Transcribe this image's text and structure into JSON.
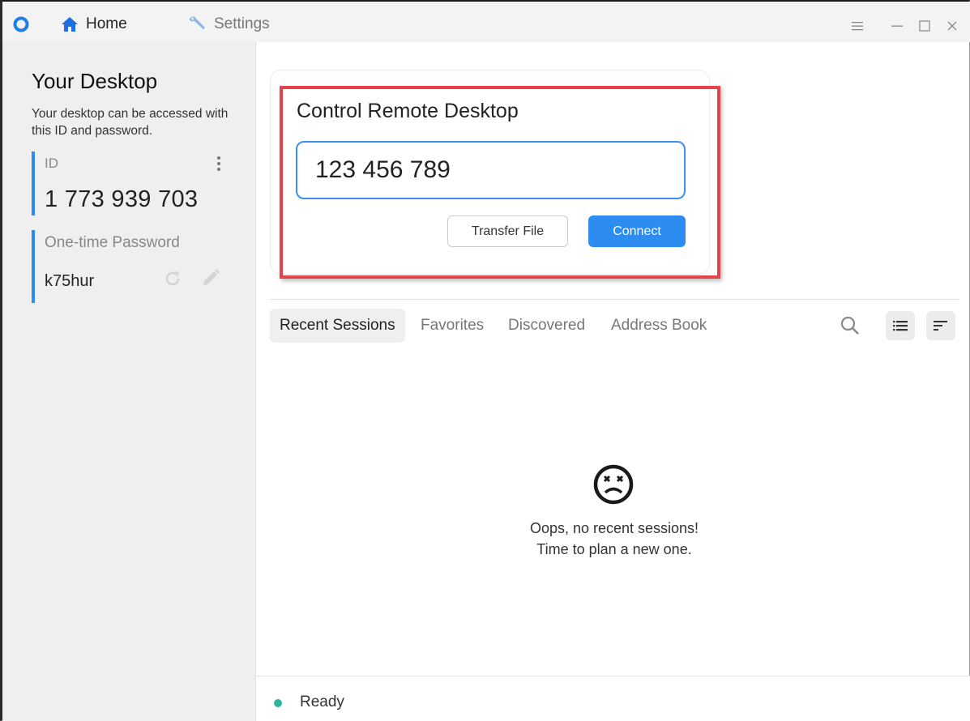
{
  "titlebar": {
    "nav": [
      {
        "label": "Home",
        "icon": "home-icon",
        "active": true
      },
      {
        "label": "Settings",
        "icon": "wrench-icon",
        "active": false
      }
    ]
  },
  "sidebar": {
    "title": "Your Desktop",
    "description": "Your desktop can be accessed with this ID and password.",
    "id_label": "ID",
    "id_value": "1 773 939 703",
    "password_label": "One-time Password",
    "password_value": "k75hur"
  },
  "connect_card": {
    "title": "Control Remote Desktop",
    "input_value": "123 456 789",
    "transfer_label": "Transfer File",
    "connect_label": "Connect"
  },
  "tabs": [
    {
      "label": "Recent Sessions",
      "active": true
    },
    {
      "label": "Favorites",
      "active": false
    },
    {
      "label": "Discovered",
      "active": false
    },
    {
      "label": "Address Book",
      "active": false
    }
  ],
  "empty_state": {
    "line1": "Oops, no recent sessions!",
    "line2": "Time to plan a new one."
  },
  "status": {
    "text": "Ready",
    "color": "#2bb5a0"
  },
  "colors": {
    "accent": "#2d8cf0",
    "highlight": "#e5434b"
  }
}
